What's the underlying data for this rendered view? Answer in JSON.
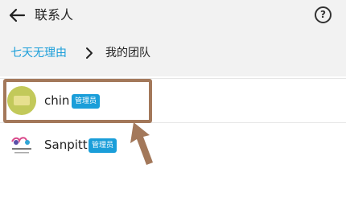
{
  "header": {
    "title": "联系人",
    "back_icon": "arrow-left-icon",
    "help_label": "?",
    "help_icon": "question-circle-icon"
  },
  "breadcrumb": {
    "items": [
      "七天无理由",
      "我的团队"
    ],
    "separator_icon": "chevron-right-icon",
    "link_color": "#1a9ed9"
  },
  "members": [
    {
      "name": "chin",
      "badge": "管理员",
      "avatar": "avatar-olive"
    },
    {
      "name": "Sanpitt",
      "badge": "管理员",
      "avatar": "avatar-logo"
    }
  ],
  "annotation": {
    "color": "#a3785a",
    "type": "highlight-box-with-arrow"
  }
}
